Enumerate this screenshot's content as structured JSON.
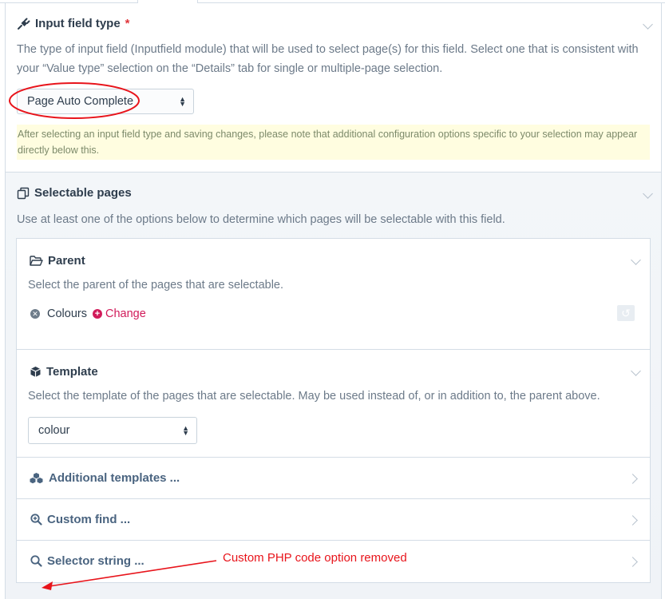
{
  "input_field": {
    "title": "Input field type",
    "required_mark": "*",
    "description": "The type of input field (Inputfield module) that will be used to select page(s) for this field. Select one that is consistent with your “Value type” selection on the “Details” tab for single or multiple-page selection.",
    "select_value": "Page Auto Complete",
    "note": "After selecting an input field type and saving changes, please note that additional configuration options specific to your selection may appear directly below this."
  },
  "selectable_pages": {
    "title": "Selectable pages",
    "description": "Use at least one of the options below to determine which pages will be selectable with this field.",
    "parent": {
      "title": "Parent",
      "description": "Select the parent of the pages that are selectable.",
      "selected_page": "Colours",
      "change_label": "Change"
    },
    "template": {
      "title": "Template",
      "description": "Select the template of the pages that are selectable. May be used instead of, or in addition to, the parent above.",
      "select_value": "colour"
    },
    "collapsed": [
      {
        "label": "Additional templates ..."
      },
      {
        "label": "Custom find ..."
      },
      {
        "label": "Selector string ..."
      }
    ]
  },
  "annotation": {
    "text": "Custom PHP code option removed",
    "color": "#e8141b"
  },
  "colors": {
    "accent": "#d11b5a",
    "note_bg": "#fffde0",
    "border": "#d4dde6"
  }
}
